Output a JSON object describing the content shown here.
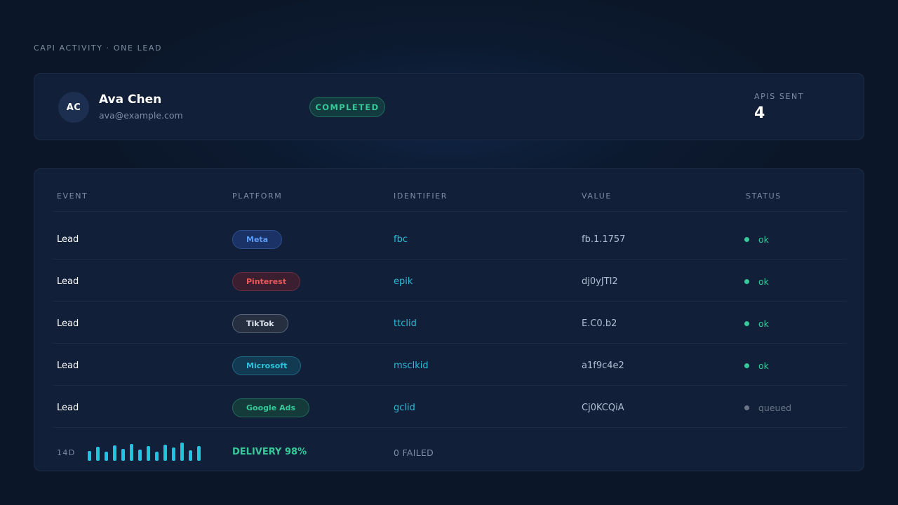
{
  "page": {
    "label": "CAPI ACTIVITY · ONE LEAD"
  },
  "lead": {
    "initials": "AC",
    "name": "Ava Chen",
    "email": "ava@example.com",
    "status": "COMPLETED",
    "apis_sent_label": "APIS SENT",
    "apis_sent_value": "4"
  },
  "table": {
    "columns": [
      "EVENT",
      "PLATFORM",
      "IDENTIFIER",
      "VALUE",
      "STATUS"
    ],
    "rows": [
      {
        "event": "Lead",
        "platform": "Meta",
        "identifier": "fbc",
        "value": "fb.1.1757",
        "status": "ok"
      },
      {
        "event": "Lead",
        "platform": "Pinterest",
        "identifier": "epik",
        "value": "dj0yJTI2",
        "status": "ok"
      },
      {
        "event": "Lead",
        "platform": "TikTok",
        "identifier": "ttclid",
        "value": "E.C0.b2",
        "status": "ok"
      },
      {
        "event": "Lead",
        "platform": "Microsoft",
        "identifier": "msclkid",
        "value": "a1f9c4e2",
        "status": "ok"
      },
      {
        "event": "Lead",
        "platform": "Google Ads",
        "identifier": "gclid",
        "value": "Cj0KCQiA",
        "status": "queued"
      }
    ]
  },
  "footer": {
    "range_label": "14D",
    "sparkline": [
      14,
      20,
      13,
      22,
      17,
      24,
      16,
      21,
      13,
      23,
      19,
      26,
      15,
      21
    ],
    "delivery": "DELIVERY 98%",
    "failed": "0 FAILED"
  },
  "colors": {
    "accent_green": "#36c99a",
    "accent_cyan": "#22c3e0",
    "platforms": {
      "Meta": {
        "fg": "#5b9af5",
        "bg": "#1a3265",
        "border": "#2c4f8f"
      },
      "Pinterest": {
        "fg": "#e55a5a",
        "bg": "#3b1e30",
        "border": "#6a2f3e"
      },
      "TikTok": {
        "fg": "#dfe6ef",
        "bg": "#262f40",
        "border": "#59657a"
      },
      "Microsoft": {
        "fg": "#2bc3dc",
        "bg": "#123a52",
        "border": "#1e6783"
      },
      "Google Ads": {
        "fg": "#36c99a",
        "bg": "#143a3a",
        "border": "#226b5a"
      }
    },
    "status": {
      "ok": "#36c99a",
      "queued": "#6b7587"
    }
  }
}
